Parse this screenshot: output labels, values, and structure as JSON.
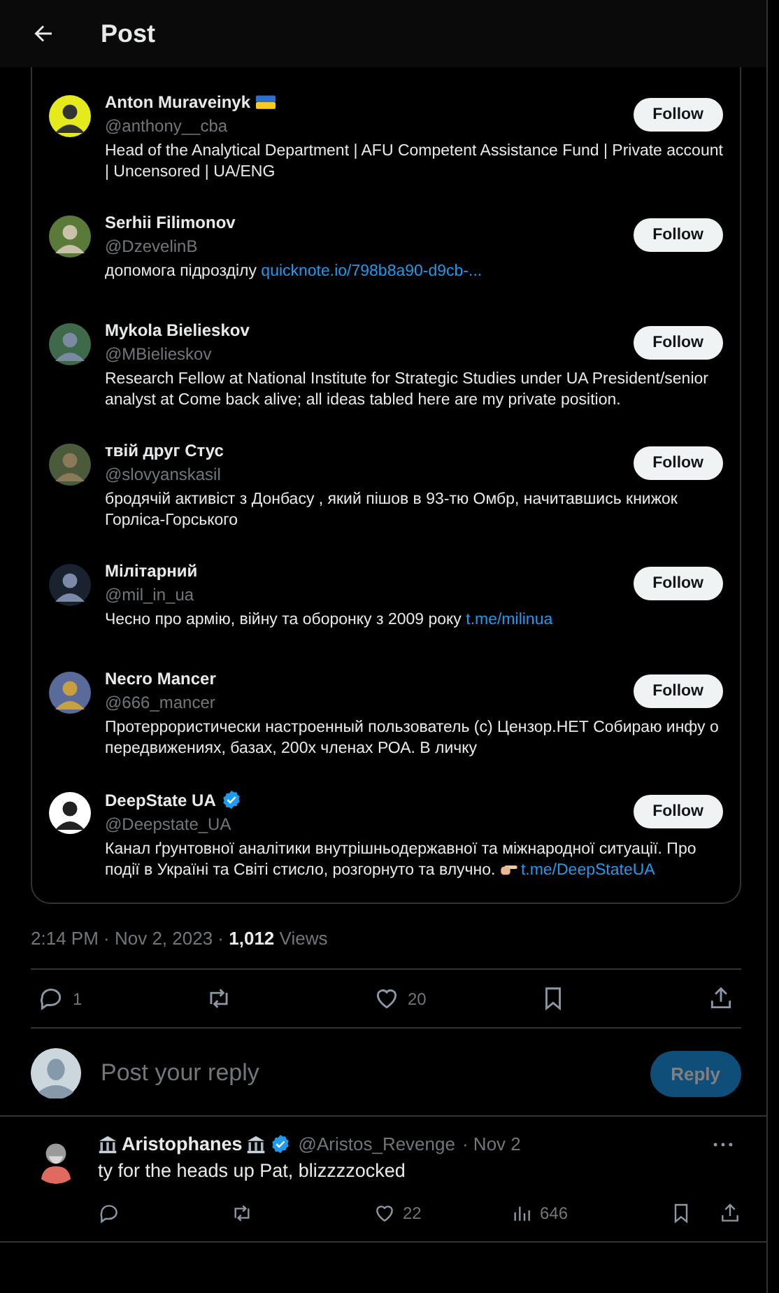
{
  "header": {
    "title": "Post"
  },
  "accounts": [
    {
      "name": "Anton Muraveinyk",
      "flag": true,
      "handle": "@anthony__cba",
      "bio": [
        {
          "kind": "text",
          "text": "Head of the Analytical Department | AFU Competent Assistance Fund | Private account | Uncensored | UA/ENG"
        }
      ],
      "button": "Follow"
    },
    {
      "name": "Serhii Filimonov",
      "handle": "@DzevelinB",
      "bio": [
        {
          "kind": "text",
          "text": "допомога підрозділу "
        },
        {
          "kind": "link",
          "text": "quicknote.io/798b8a90-d9cb-..."
        }
      ],
      "button": "Follow"
    },
    {
      "name": "Mykola Bielieskov",
      "handle": "@MBielieskov",
      "bio": [
        {
          "kind": "text",
          "text": "Research Fellow at National Institute for Strategic Studies under UA President/senior analyst at Come back alive; all ideas tabled here are my private position."
        }
      ],
      "button": "Follow"
    },
    {
      "name": "твій друг Стус",
      "handle": "@slovyanskasil",
      "bio": [
        {
          "kind": "text",
          "text": "бродячій активіст з Донбасу , який пішов в 93-тю Омбр, начитавшись книжок Горліса-Горського"
        }
      ],
      "button": "Follow"
    },
    {
      "name": "Мілітарний",
      "handle": "@mil_in_ua",
      "bio": [
        {
          "kind": "text",
          "text": "Чесно про армію, війну та оборонку з 2009 року "
        },
        {
          "kind": "link",
          "text": "t.me/milinua"
        }
      ],
      "button": "Follow"
    },
    {
      "name": "Necro Mancer",
      "handle": "@666_mancer",
      "bio": [
        {
          "kind": "text",
          "text": "Протеррористически настроенный пользователь (c) Цензор.НЕТ Собираю инфу о передвижениях, базах, 200х членах РОА. В личку"
        }
      ],
      "button": "Follow"
    },
    {
      "name": "DeepState UA",
      "verified": true,
      "handle": "@Deepstate_UA",
      "bio": [
        {
          "kind": "text",
          "text": "Канал ґрунтовної аналітики внутрішньодержавної та міжнародної ситуації. Про події в Україні та Світі стисло, розгорнуто та влучно. "
        },
        {
          "kind": "pointing-hand"
        },
        {
          "kind": "link",
          "text": "t.me/DeepStateUA"
        }
      ],
      "button": "Follow"
    }
  ],
  "meta": {
    "time": "2:14 PM · Nov 2, 2023 · ",
    "views_count": "1,012",
    "views_label": "Views"
  },
  "actions": [
    {
      "kind": "reply",
      "count": "1"
    },
    {
      "kind": "repost"
    },
    {
      "kind": "like",
      "count": "20"
    },
    {
      "kind": "bookmark"
    },
    {
      "kind": "share"
    }
  ],
  "composer": {
    "placeholder": "Post your reply",
    "button": "Reply",
    "disabled": true
  },
  "reply": {
    "name": "Aristophanes",
    "verified": true,
    "handle": "@Aristos_Revenge",
    "date": "· Nov 2",
    "text": "ty for the heads up Pat, blizzzzocked",
    "actions": [
      {
        "kind": "reply"
      },
      {
        "kind": "repost"
      },
      {
        "kind": "like",
        "count": "22"
      },
      {
        "kind": "views",
        "count": "646"
      },
      {
        "kind": "bookmark"
      },
      {
        "kind": "share"
      }
    ]
  }
}
